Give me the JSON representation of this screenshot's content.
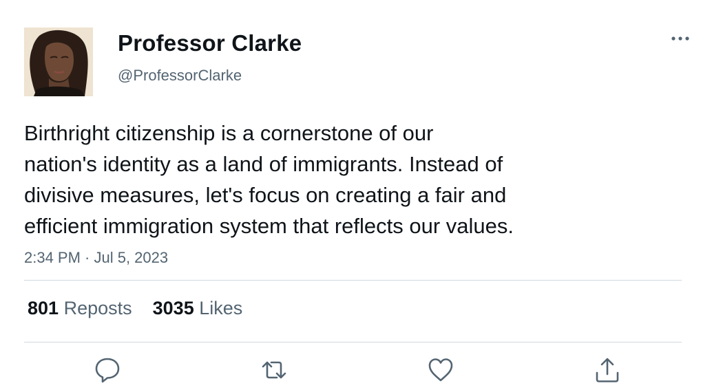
{
  "author": {
    "display_name": "Professor Clarke",
    "handle": "@ProfessorClarke",
    "avatar_icon": "profile-photo"
  },
  "tweet": {
    "lines": [
      "Birthright citizenship is a cornerstone of our",
      "nation's identity as a land of immigrants. Instead of",
      "divisive measures, let's focus on creating a fair and",
      "efficient immigration system that reflects our values."
    ],
    "timestamp": "2:34 PM · Jul 5, 2023"
  },
  "stats": {
    "reposts_count": "801",
    "reposts_label": "Reposts",
    "likes_count": "3035",
    "likes_label": "Likes"
  },
  "actions": [
    "reply-icon",
    "repost-icon",
    "like-icon",
    "share-icon"
  ],
  "colors": {
    "text_primary": "#0f1419",
    "text_secondary": "#536471",
    "icon": "#536471",
    "divider": "#cfd9de"
  }
}
